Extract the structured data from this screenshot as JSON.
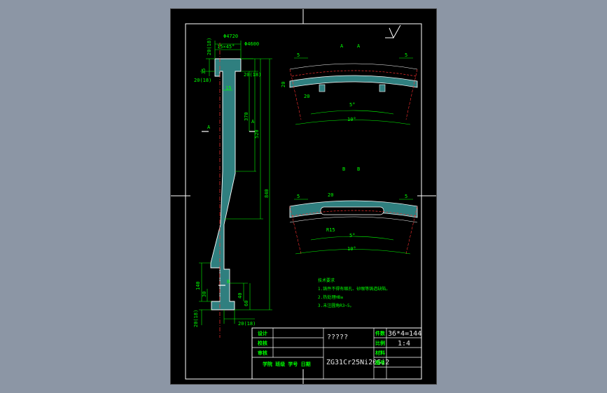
{
  "dims": {
    "d4720": "Φ4720",
    "d4600": "Φ4600",
    "chamfer": "15×45°",
    "top20": "20(18)",
    "d35": "35",
    "left20": "20(18)",
    "d15": "15",
    "r20": "20(18)",
    "d370": "370",
    "d520": "520",
    "d840": "840",
    "d140": "140",
    "d30": "30",
    "d40": "40",
    "d60": "60",
    "bot20": "20(18)",
    "bot20b": "20(18)"
  },
  "markers": {
    "A": "A",
    "B": "B"
  },
  "section_a": {
    "title_left": "A",
    "title_right": "A",
    "d5l": "5",
    "d5r": "5",
    "d20": "20",
    "d20v": "20",
    "ang5": "5°",
    "ang10": "10°"
  },
  "section_b": {
    "title_left": "B",
    "title_right": "B",
    "d5l": "5",
    "d5r": "5",
    "d20": "20",
    "r15": "R15",
    "ang5": "5°",
    "ang10": "10°"
  },
  "notes": {
    "title": "技术要求",
    "line1": "1.铸件不得有缩孔、砂眼等铸造缺陷。",
    "line2": "2.热处理HB≥",
    "line3": "3.未注圆角R3~5。"
  },
  "title_block": {
    "design": "设计",
    "check": "校核",
    "review": "审核",
    "stamp": "学院  班级  学号  日期",
    "name": "?????",
    "material": "ZG31Cr25Ni20Si2",
    "qty_label": "件数",
    "qty": "36*4=144",
    "scale_label": "比例",
    "scale": "1:4",
    "mat_label": "材料",
    "drw_label": "图号"
  }
}
